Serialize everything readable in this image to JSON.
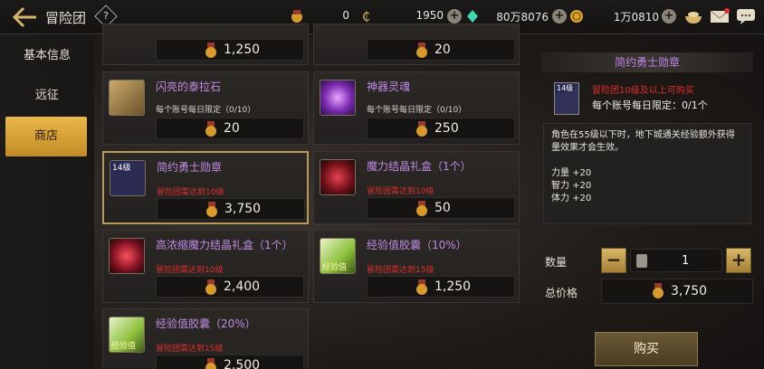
{
  "header": {
    "title": "冒险团",
    "help": "?",
    "currencies": [
      {
        "icon": "gold-medal-icon",
        "value": "0"
      },
      {
        "icon": "cera-coin-icon",
        "value": "1950"
      },
      {
        "icon": "crystal-icon",
        "value": "80万8076"
      },
      {
        "icon": "gold-coin-icon",
        "value": "1万0810"
      }
    ]
  },
  "sidebar": {
    "items": [
      {
        "label": "基本信息"
      },
      {
        "label": "远征"
      },
      {
        "label": "商店"
      }
    ]
  },
  "shop": {
    "top_prices": [
      "1,250",
      "20"
    ],
    "items": [
      {
        "name": "闪亮的泰拉石",
        "limit": "每个账号每日限定（0/10）",
        "price": "20"
      },
      {
        "name": "神器灵魂",
        "limit": "每个账号每日限定（0/10）",
        "price": "250"
      },
      {
        "name": "简约勇士勋章",
        "badge": "14级",
        "req": "冒险团需达到10级",
        "price": "3,750"
      },
      {
        "name": "魔力结晶礼盒（1个）",
        "req": "冒险团需达到10级",
        "price": "50"
      },
      {
        "name": "高浓缩魔力结晶礼盒（1个）",
        "req": "冒险团需达到10级",
        "price": "2,400"
      },
      {
        "name": "经验值胶囊（10%）",
        "req": "冒险团需达到15级",
        "price": "1,250",
        "thumb_text": "经验值"
      },
      {
        "name": "经验值胶囊（20%）",
        "req": "冒险团需达到15级",
        "price": "2,500",
        "thumb_text": "经验值"
      }
    ]
  },
  "detail": {
    "title": "简约勇士勋章",
    "badge": "14级",
    "req": "冒险团10级及以上可购买",
    "limit": "每个账号每日限定：0/1个",
    "desc": "角色在55级以下时，地下城通关经验额外获得量效果才会生效。",
    "stats": [
      "力量 +20",
      "智力 +20",
      "体力 +20"
    ],
    "qty_label": "数量",
    "qty": "1",
    "total_label": "总价格",
    "total": "3,750",
    "buy_label": "购买"
  },
  "colors": {
    "accent": "#e9b84a",
    "name_purple": "#c08be6",
    "req_red": "#e0302a"
  }
}
